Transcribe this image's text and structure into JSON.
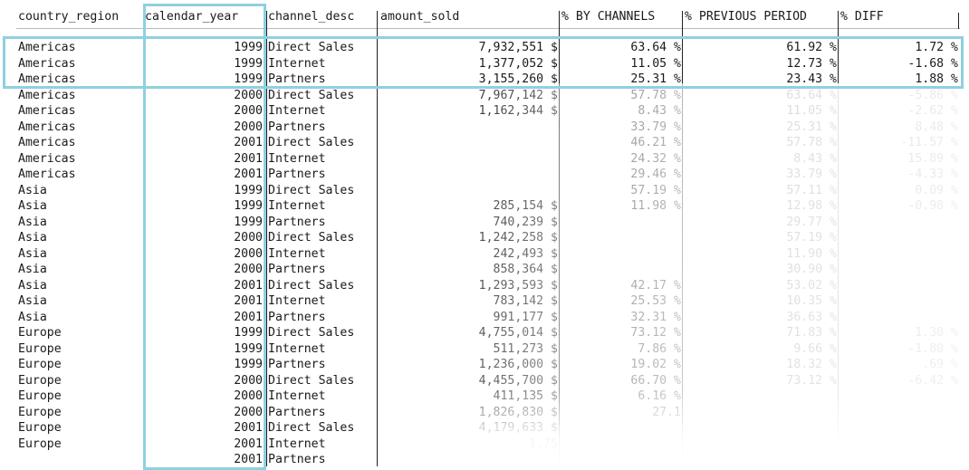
{
  "columns": [
    "country_region",
    "calendar_year",
    "channel_desc",
    "amount_sold",
    "% BY CHANNELS",
    "% PREVIOUS PERIOD",
    "% DIFF"
  ],
  "rows": [
    [
      "Americas",
      "1999",
      "Direct Sales",
      "7,932,551 $",
      "63.64 %",
      "61.92 %",
      "1.72 %"
    ],
    [
      "Americas",
      "1999",
      "Internet",
      "1,377,052 $",
      "11.05 %",
      "12.73 %",
      "-1.68 %"
    ],
    [
      "Americas",
      "1999",
      "Partners",
      "3,155,260 $",
      "25.31 %",
      "23.43 %",
      "1.88 %"
    ],
    [
      "Americas",
      "2000",
      "Direct Sales",
      "7,967,142 $",
      "57.78 %",
      "63.64 %",
      "-5.86 %"
    ],
    [
      "Americas",
      "2000",
      "Internet",
      "1,162,344 $",
      "8.43 %",
      "11.05 %",
      "-2.62 %"
    ],
    [
      "Americas",
      "2000",
      "Partners",
      "",
      "33.79 %",
      "25.31 %",
      "8.48 %"
    ],
    [
      "Americas",
      "2001",
      "Direct Sales",
      "",
      "46.21 %",
      "57.78 %",
      "-11.57 %"
    ],
    [
      "Americas",
      "2001",
      "Internet",
      "",
      "24.32 %",
      "8.43 %",
      "15.89 %"
    ],
    [
      "Americas",
      "2001",
      "Partners",
      "",
      "29.46 %",
      "33.79 %",
      "-4.33 %"
    ],
    [
      "Asia",
      "1999",
      "Direct Sales",
      "",
      "57.19 %",
      "57.11 %",
      "0.09 %"
    ],
    [
      "Asia",
      "1999",
      "Internet",
      "285,154 $",
      "11.98 %",
      "12.98 %",
      "-0.98 %"
    ],
    [
      "Asia",
      "1999",
      "Partners",
      "740,239 $",
      "",
      "29.77 %",
      ""
    ],
    [
      "Asia",
      "2000",
      "Direct Sales",
      "1,242,258 $",
      "",
      "57.19 %",
      ""
    ],
    [
      "Asia",
      "2000",
      "Internet",
      "242,493 $",
      "",
      "11.90 %",
      ""
    ],
    [
      "Asia",
      "2000",
      "Partners",
      "858,364 $",
      "",
      "30.90 %",
      ""
    ],
    [
      "Asia",
      "2001",
      "Direct Sales",
      "1,293,593 $",
      "42.17 %",
      "53.02 %",
      ""
    ],
    [
      "Asia",
      "2001",
      "Internet",
      "783,142 $",
      "25.53 %",
      "10.35 %",
      ""
    ],
    [
      "Asia",
      "2001",
      "Partners",
      "991,177 $",
      "32.31 %",
      "36.63 %",
      ""
    ],
    [
      "Europe",
      "1999",
      "Direct Sales",
      "4,755,014 $",
      "73.12 %",
      "71.83 %",
      "1.30 %"
    ],
    [
      "Europe",
      "1999",
      "Internet",
      "511,273 $",
      "7.86 %",
      "9.66 %",
      "-1.80 %"
    ],
    [
      "Europe",
      "1999",
      "Partners",
      "1,236,000 $",
      "19.02 %",
      "18.32 %",
      ".69 %"
    ],
    [
      "Europe",
      "2000",
      "Direct Sales",
      "4,455,700 $",
      "66.70 %",
      "73.12 %",
      "-6.42 %"
    ],
    [
      "Europe",
      "2000",
      "Internet",
      "411,135 $",
      "6.16 %",
      "",
      ""
    ],
    [
      "Europe",
      "2000",
      "Partners",
      "1,826,830 $",
      "27.1",
      "",
      ""
    ],
    [
      "Europe",
      "2001",
      "Direct Sales",
      "4,179,633 $",
      "",
      "",
      ""
    ],
    [
      "Europe",
      "2001",
      "Internet",
      "1.75",
      "",
      "",
      ""
    ],
    [
      "",
      "2001",
      "Partners",
      "",
      "",
      "",
      ""
    ]
  ]
}
